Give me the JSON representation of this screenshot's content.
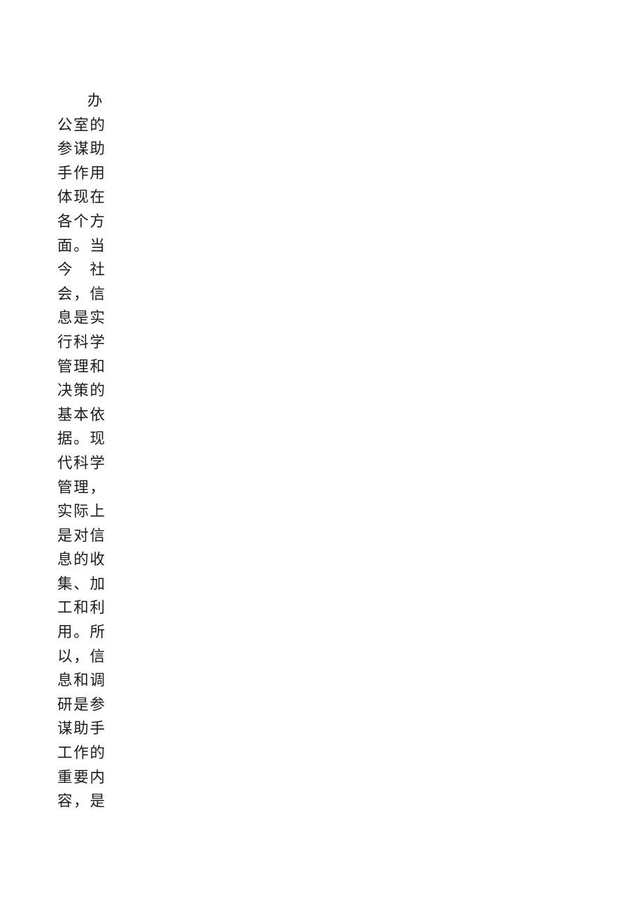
{
  "document": {
    "page_background": "#ffffff",
    "text_color": "#1b1b1b",
    "body": {
      "paragraph": "办公室的参谋助手作用体现在各个方面。当今社会，信息是实行科学管理和决策的基本依据。现代科学管理，实际上是对信息的收集、加工和利用。所以，信息和调研是参谋助手工作的重要内容，是"
    }
  }
}
